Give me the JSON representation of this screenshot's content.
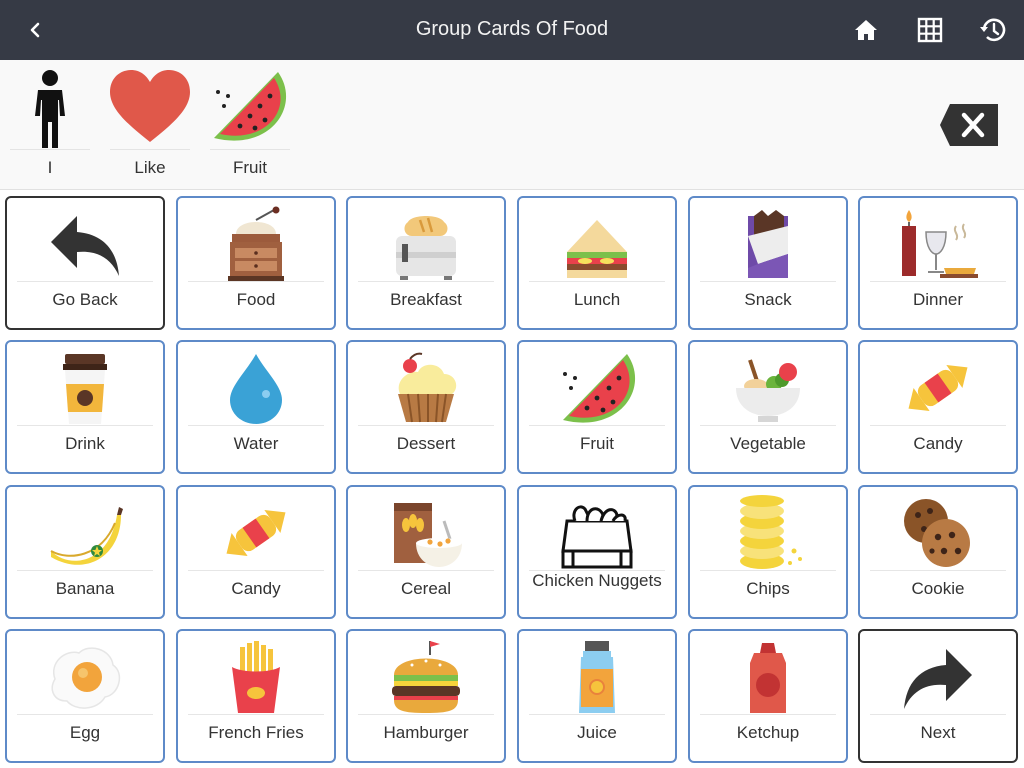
{
  "header": {
    "title": "Group Cards Of Food",
    "back_icon": "chevron-left-icon",
    "home_icon": "home-icon",
    "grid_icon": "grid-icon",
    "history_icon": "history-icon",
    "bg_color": "#363a45"
  },
  "sentence": {
    "items": [
      {
        "label": "I",
        "icon": "person-icon"
      },
      {
        "label": "Like",
        "icon": "heart-icon"
      },
      {
        "label": "Fruit",
        "icon": "watermelon-icon"
      }
    ],
    "clear_icon": "backspace-icon"
  },
  "cards": [
    {
      "label": "Go Back",
      "icon": "back-arrow-icon"
    },
    {
      "label": "Food",
      "icon": "coffee-grinder-icon"
    },
    {
      "label": "Breakfast",
      "icon": "toaster-icon"
    },
    {
      "label": "Lunch",
      "icon": "sandwich-icon"
    },
    {
      "label": "Snack",
      "icon": "chocolate-bar-icon"
    },
    {
      "label": "Dinner",
      "icon": "dinner-icon"
    },
    {
      "label": "Drink",
      "icon": "coffee-cup-icon"
    },
    {
      "label": "Water",
      "icon": "water-drop-icon"
    },
    {
      "label": "Dessert",
      "icon": "cupcake-icon"
    },
    {
      "label": "Fruit",
      "icon": "watermelon-icon"
    },
    {
      "label": "Vegetable",
      "icon": "salad-bowl-icon"
    },
    {
      "label": "Candy",
      "icon": "candy-icon"
    },
    {
      "label": "Banana",
      "icon": "banana-icon"
    },
    {
      "label": "Candy",
      "icon": "candy-icon"
    },
    {
      "label": "Cereal",
      "icon": "cereal-icon"
    },
    {
      "label": "Chicken Nuggets",
      "icon": "chicken-nuggets-icon"
    },
    {
      "label": "Chips",
      "icon": "chips-icon"
    },
    {
      "label": "Cookie",
      "icon": "cookie-icon"
    },
    {
      "label": "Egg",
      "icon": "egg-icon"
    },
    {
      "label": "French Fries",
      "icon": "french-fries-icon"
    },
    {
      "label": "Hamburger",
      "icon": "hamburger-icon"
    },
    {
      "label": "Juice",
      "icon": "juice-bottle-icon"
    },
    {
      "label": "Ketchup",
      "icon": "ketchup-icon"
    },
    {
      "label": "Next",
      "icon": "forward-arrow-icon"
    }
  ],
  "colors": {
    "card_border": "#5e8ac8",
    "nav_card_border": "#333333",
    "accent_red": "#e0584a"
  }
}
